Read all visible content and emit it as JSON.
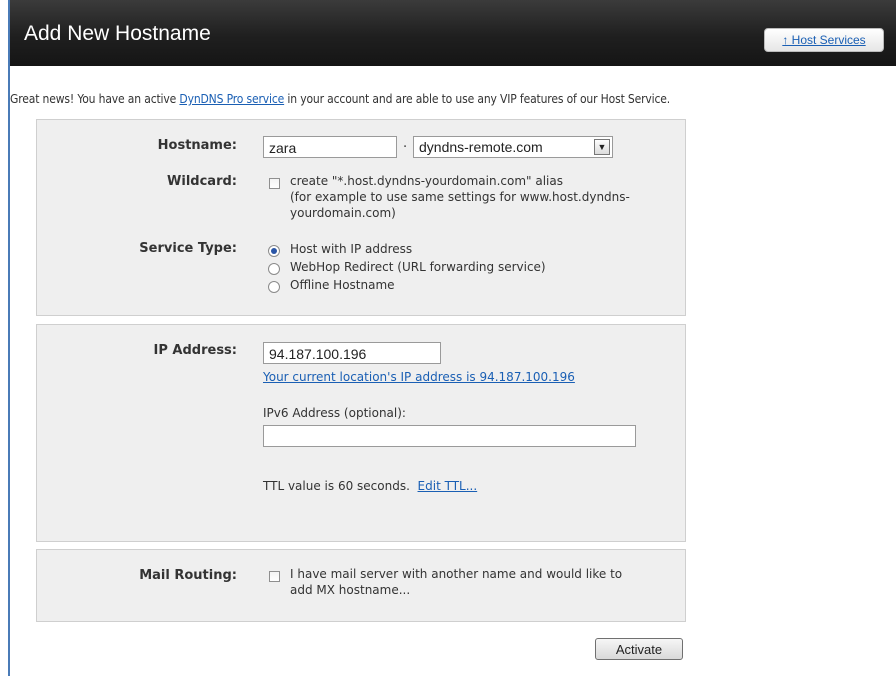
{
  "header": {
    "title": "Add New Hostname",
    "host_services_link": "↑ Host Services"
  },
  "intro": {
    "prefix": "Great news! You have an active ",
    "link": "DynDNS Pro service",
    "suffix": " in your account and are able to use any VIP features of our Host Service."
  },
  "hostname": {
    "label": "Hostname:",
    "value": "zara",
    "separator": "·",
    "domain": "dyndns-remote.com"
  },
  "wildcard": {
    "label": "Wildcard:",
    "lines": [
      "create \"*.host.dyndns-yourdomain.com\" alias",
      "(for example to use same settings for www.host.dyndns-",
      "yourdomain.com)"
    ],
    "checked": false
  },
  "service_type": {
    "label": "Service Type:",
    "options": [
      "Host with IP address",
      "WebHop Redirect (URL forwarding service)",
      "Offline Hostname"
    ],
    "selected": "Host with IP address"
  },
  "ip": {
    "label": "IP Address:",
    "value": "94.187.100.196",
    "current_location_link": "Your current location's IP address is 94.187.100.196",
    "ipv6_label": "IPv6 Address (optional):",
    "ipv6_value": "",
    "ttl_text": "TTL value is 60 seconds.",
    "ttl_link": "Edit TTL..."
  },
  "mail": {
    "label": "Mail Routing:",
    "lines": [
      "I have mail server with another name and would like to",
      "add MX hostname..."
    ],
    "checked": false
  },
  "activate_label": "Activate",
  "colors": {
    "header_bg": "#1f1f1f",
    "link": "#1a5fb4",
    "panel_bg": "#efefef",
    "accent_border": "#4a7bb7"
  }
}
